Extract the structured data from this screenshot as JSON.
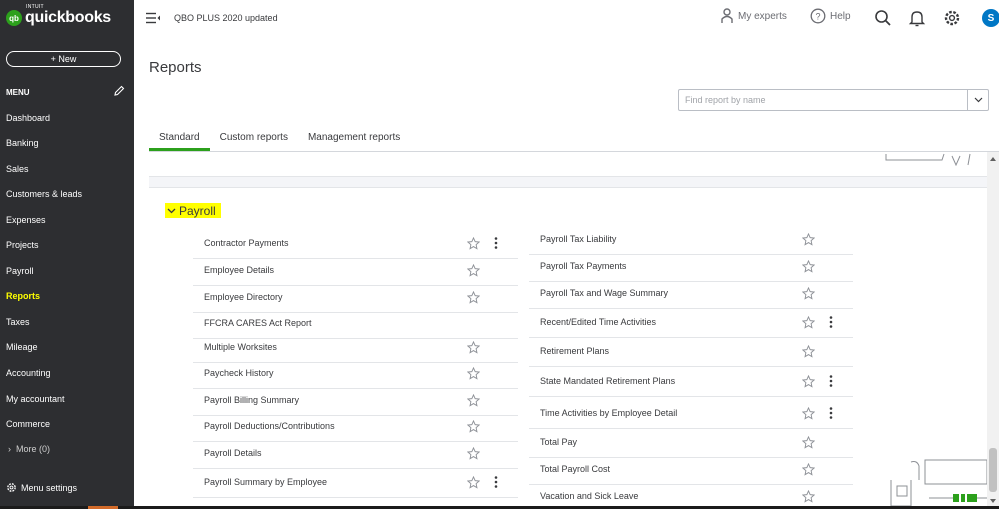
{
  "brand": {
    "intuit": "INTUIT",
    "name": "quickbooks",
    "mark": "qb"
  },
  "sidebar": {
    "new_label": "+ New",
    "menu_label": "MENU",
    "items": [
      {
        "label": "Dashboard",
        "active": false
      },
      {
        "label": "Banking",
        "active": false
      },
      {
        "label": "Sales",
        "active": false
      },
      {
        "label": "Customers & leads",
        "active": false
      },
      {
        "label": "Expenses",
        "active": false
      },
      {
        "label": "Projects",
        "active": false
      },
      {
        "label": "Payroll",
        "active": false
      },
      {
        "label": "Reports",
        "active": true
      },
      {
        "label": "Taxes",
        "active": false
      },
      {
        "label": "Mileage",
        "active": false
      },
      {
        "label": "Accounting",
        "active": false
      },
      {
        "label": "My accountant",
        "active": false
      },
      {
        "label": "Commerce",
        "active": false
      }
    ],
    "more_label": "More (0)",
    "settings_label": "Menu settings"
  },
  "header": {
    "company": "QBO PLUS 2020 updated",
    "my_experts": "My experts",
    "help": "Help",
    "avatar_initial": "S"
  },
  "page": {
    "title": "Reports",
    "search_placeholder": "Find report by name",
    "tabs": [
      {
        "label": "Standard",
        "active": true
      },
      {
        "label": "Custom reports",
        "active": false
      },
      {
        "label": "Management reports",
        "active": false
      }
    ]
  },
  "payroll": {
    "section_title": "Payroll",
    "left_reports": [
      {
        "label": "Contractor Payments",
        "star": true,
        "menu": true
      },
      {
        "label": "Employee Details",
        "star": true,
        "menu": false
      },
      {
        "label": "Employee Directory",
        "star": true,
        "menu": false
      },
      {
        "label": "FFCRA CARES Act Report",
        "star": false,
        "menu": false
      },
      {
        "label": "Multiple Worksites",
        "star": true,
        "menu": false
      },
      {
        "label": "Paycheck History",
        "star": true,
        "menu": false
      },
      {
        "label": "Payroll Billing Summary",
        "star": true,
        "menu": false
      },
      {
        "label": "Payroll Deductions/Contributions",
        "star": true,
        "menu": false
      },
      {
        "label": "Payroll Details",
        "star": true,
        "menu": false
      },
      {
        "label": "Payroll Summary by Employee",
        "star": true,
        "menu": true
      }
    ],
    "right_reports": [
      {
        "label": "Payroll Tax Liability",
        "star": true,
        "menu": false
      },
      {
        "label": "Payroll Tax Payments",
        "star": true,
        "menu": false
      },
      {
        "label": "Payroll Tax and Wage Summary",
        "star": true,
        "menu": false
      },
      {
        "label": "Recent/Edited Time Activities",
        "star": true,
        "menu": true
      },
      {
        "label": "Retirement Plans",
        "star": true,
        "menu": false
      },
      {
        "label": "State Mandated Retirement Plans",
        "star": true,
        "menu": true
      },
      {
        "label": "Time Activities by Employee Detail",
        "star": true,
        "menu": true
      },
      {
        "label": "Total Pay",
        "star": true,
        "menu": false
      },
      {
        "label": "Total Payroll Cost",
        "star": true,
        "menu": false
      },
      {
        "label": "Vacation and Sick Leave",
        "star": true,
        "menu": false
      }
    ]
  },
  "colors": {
    "sidebar_bg": "#2d2e31",
    "accent_green": "#2ca01c",
    "highlight": "#ffff00",
    "avatar_blue": "#0077c5"
  }
}
